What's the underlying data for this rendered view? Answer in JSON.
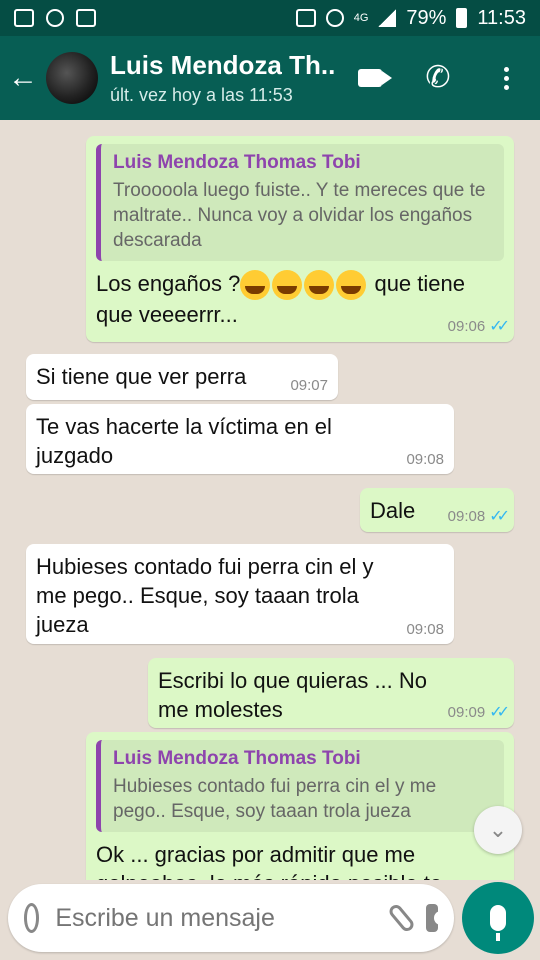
{
  "status_bar": {
    "network": "4G",
    "battery": "79%",
    "time": "11:53"
  },
  "header": {
    "contact_name": "Luis Mendoza Th...",
    "last_seen": "últ. vez hoy a las 11:53"
  },
  "messages": [
    {
      "direction": "out",
      "quote_author": "Luis Mendoza Thomas Tobi",
      "quote_text": "Trooooola luego fuiste.. Y te mereces que te maltrate.. Nunca voy a olvidar los engaños descarada",
      "text_before_emoji": "Los engaños ?",
      "emoji_count": 4,
      "text_after_emoji": " que tiene que veeeerrr...",
      "time": "09:06",
      "status": "read"
    },
    {
      "direction": "in",
      "text": "Si tiene que ver perra",
      "time": "09:07"
    },
    {
      "direction": "in",
      "text": "Te vas hacerte la víctima  en el juzgado",
      "time": "09:08"
    },
    {
      "direction": "out",
      "text": "Dale",
      "time": "09:08",
      "status": "read"
    },
    {
      "direction": "in",
      "text": "Hubieses contado  fui perra cin el y me pego.. Esque, soy taaan trola jueza",
      "time": "09:08"
    },
    {
      "direction": "out",
      "text": "Escribi lo que quieras ... No me molestes",
      "time": "09:09",
      "status": "read"
    },
    {
      "direction": "out",
      "quote_author": "Luis Mendoza Thomas Tobi",
      "quote_text": "Hubieses contado  fui perra cin el y me pego.. Esque, soy taaan trola jueza",
      "text": "Ok ... gracias por admitir que me golpeabas, lo más rápido posible te"
    }
  ],
  "composer": {
    "placeholder": "Escribe un mensaje"
  },
  "icons": {
    "back": "arrow-left-icon",
    "video": "video-call-icon",
    "call": "phone-icon",
    "menu": "more-vert-icon",
    "emoji": "emoji-icon",
    "attach": "paperclip-icon",
    "camera": "camera-icon",
    "mic": "mic-icon",
    "scroll": "chevron-double-down-icon"
  },
  "colors": {
    "header": "#075e54",
    "status_bar": "#054d44",
    "outgoing_bubble": "#dcf8c6",
    "incoming_bubble": "#ffffff",
    "quote_accent": "#8e44ad",
    "read_ticks": "#34b7f1",
    "mic_button": "#00897b"
  }
}
